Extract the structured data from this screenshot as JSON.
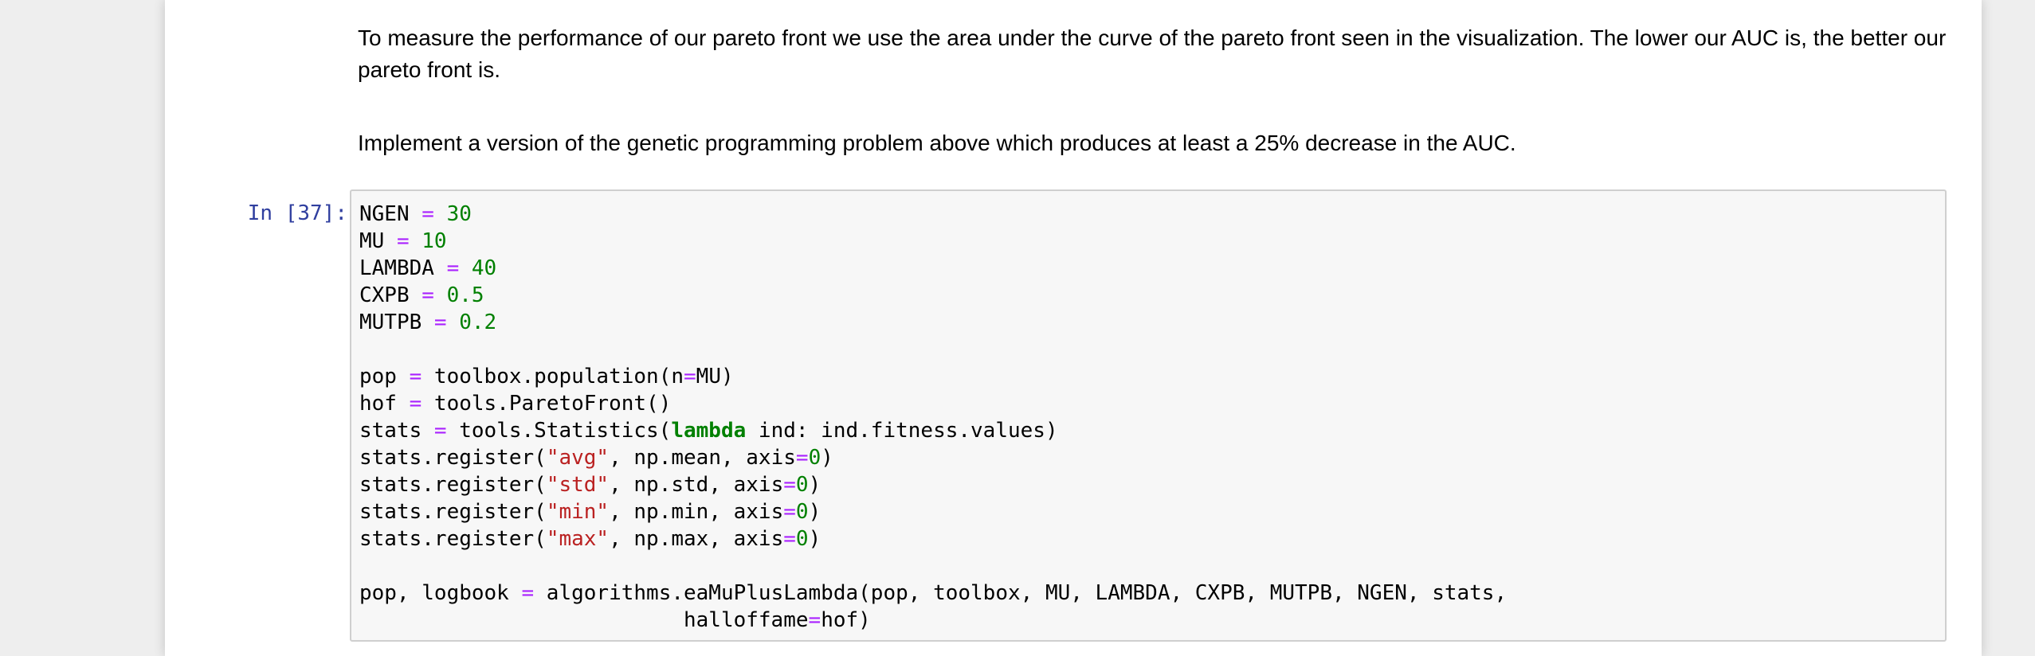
{
  "markdown": {
    "paragraph1": "To measure the performance of our pareto front we use the area under the curve of the pareto front seen in the visualization. The lower our AUC is, the better our pareto front is.",
    "paragraph2": "Implement a version of the genetic programming problem above which produces at least a 25% decrease in the AUC."
  },
  "cell": {
    "prompt": "In [37]:",
    "lines": [
      [
        [
          "NGEN ",
          ""
        ],
        [
          "=",
          "o"
        ],
        [
          " ",
          ""
        ],
        [
          "30",
          "n"
        ]
      ],
      [
        [
          "MU ",
          ""
        ],
        [
          "=",
          "o"
        ],
        [
          " ",
          ""
        ],
        [
          "10",
          "n"
        ]
      ],
      [
        [
          "LAMBDA ",
          ""
        ],
        [
          "=",
          "o"
        ],
        [
          " ",
          ""
        ],
        [
          "40",
          "n"
        ]
      ],
      [
        [
          "CXPB ",
          ""
        ],
        [
          "=",
          "o"
        ],
        [
          " ",
          ""
        ],
        [
          "0.5",
          "n"
        ]
      ],
      [
        [
          "MUTPB ",
          ""
        ],
        [
          "=",
          "o"
        ],
        [
          " ",
          ""
        ],
        [
          "0.2",
          "n"
        ]
      ],
      [],
      [
        [
          "pop ",
          ""
        ],
        [
          "=",
          "o"
        ],
        [
          " toolbox.population(n",
          ""
        ],
        [
          "=",
          "o"
        ],
        [
          "MU)",
          ""
        ]
      ],
      [
        [
          "hof ",
          ""
        ],
        [
          "=",
          "o"
        ],
        [
          " tools.ParetoFront()",
          ""
        ]
      ],
      [
        [
          "stats ",
          ""
        ],
        [
          "=",
          "o"
        ],
        [
          " tools.Statistics(",
          ""
        ],
        [
          "lambda",
          "k"
        ],
        [
          " ind: ind.fitness.values)",
          ""
        ]
      ],
      [
        [
          "stats.register(",
          ""
        ],
        [
          "\"avg\"",
          "s"
        ],
        [
          ", np.mean, axis",
          ""
        ],
        [
          "=",
          "o"
        ],
        [
          "0",
          "n"
        ],
        [
          ")",
          ""
        ]
      ],
      [
        [
          "stats.register(",
          ""
        ],
        [
          "\"std\"",
          "s"
        ],
        [
          ", np.std, axis",
          ""
        ],
        [
          "=",
          "o"
        ],
        [
          "0",
          "n"
        ],
        [
          ")",
          ""
        ]
      ],
      [
        [
          "stats.register(",
          ""
        ],
        [
          "\"min\"",
          "s"
        ],
        [
          ", np.min, axis",
          ""
        ],
        [
          "=",
          "o"
        ],
        [
          "0",
          "n"
        ],
        [
          ")",
          ""
        ]
      ],
      [
        [
          "stats.register(",
          ""
        ],
        [
          "\"max\"",
          "s"
        ],
        [
          ", np.max, axis",
          ""
        ],
        [
          "=",
          "o"
        ],
        [
          "0",
          "n"
        ],
        [
          ")",
          ""
        ]
      ],
      [],
      [
        [
          "pop, logbook ",
          ""
        ],
        [
          "=",
          "o"
        ],
        [
          " algorithms.eaMuPlusLambda(pop, toolbox, MU, LAMBDA, CXPB, MUTPB, NGEN, stats,",
          ""
        ]
      ],
      [
        [
          "                          halloffame",
          ""
        ],
        [
          "=",
          "o"
        ],
        [
          "hof)",
          ""
        ]
      ]
    ]
  },
  "colors": {
    "prompt": "#303f9f",
    "operator": "#aa22ff",
    "number": "#008000",
    "keyword": "#008000",
    "string": "#ba2121",
    "cell_background": "#f7f7f7",
    "cell_border": "#cfcfcf",
    "page_background": "#eeeeee"
  }
}
